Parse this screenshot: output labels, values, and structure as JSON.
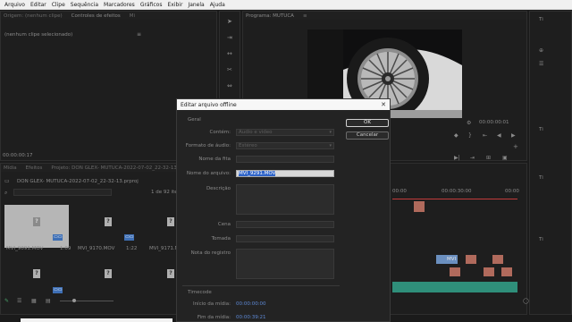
{
  "menubar": [
    "Arquivo",
    "Editar",
    "Clipe",
    "Sequência",
    "Marcadores",
    "Gráficos",
    "Exibir",
    "Janela",
    "Ajuda"
  ],
  "source_panel": {
    "tabs": [
      "Origem: (nenhum clipe)",
      "Controles de efeitos",
      "Mi"
    ],
    "no_clip": "(nenhum clipe selecionado)",
    "timecode": "00:00:00:17"
  },
  "program_panel": {
    "tab": "Programa: MUTUCA",
    "timecode": "00:00:00:01"
  },
  "project_panel": {
    "tabs": [
      "Mídia",
      "Efeitos",
      "Projeto: DON GLEX- MUTUCA-2022-07-02_22-32-13"
    ],
    "project_name": "DON GLEX- MUTUCA-2022-07-02_22-32-13.prproj",
    "count": "1 de 92 itens",
    "items": [
      {
        "name": "MVI_9091.MOV",
        "duration": "1:09"
      },
      {
        "name": "MVI_9170.MOV",
        "duration": "1:22"
      },
      {
        "name": "MVI_9171.MOV",
        "duration": ""
      }
    ]
  },
  "timeline_panel": {
    "ruler": [
      "00:00",
      "00:00:30:00",
      "00:00"
    ],
    "clip_label": "MVI"
  },
  "right_panel_labels": [
    "Ti",
    "Ti",
    "Ti"
  ],
  "dialog": {
    "title": "Editar arquivo offline",
    "section_general": "Geral",
    "fields": {
      "contem_label": "Contém:",
      "contem_value": "Áudio e vídeo",
      "formato_label": "Formato de áudio:",
      "formato_value": "Estéreo",
      "fita_label": "Nome da fita",
      "fita_value": "",
      "arquivo_label": "Nome do arquivo:",
      "arquivo_value": "MVI_9291.MOV",
      "descricao_label": "Descrição",
      "cena_label": "Cena",
      "tomada_label": "Tomada",
      "nota_label": "Nota do registro"
    },
    "ok": "OK",
    "cancel": "Cancelar",
    "section_timecode": "Timecode",
    "inicio_label": "Início da mídia:",
    "inicio_value": "00:00:00:00",
    "fim_label": "Fim da mídia:",
    "fim_value": "00:00:39:21"
  }
}
